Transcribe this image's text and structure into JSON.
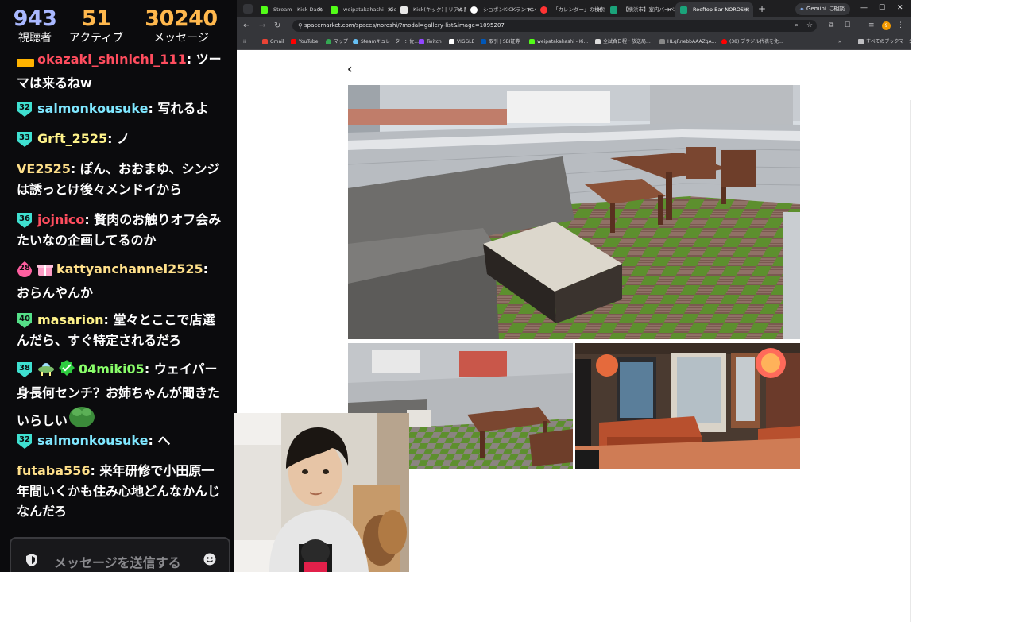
{
  "stream_stats": {
    "viewers": {
      "value": "943",
      "label": "視聴者"
    },
    "active": {
      "value": "51",
      "label": "アクティブ"
    },
    "messages": {
      "value": "30240",
      "label": "メッセージ"
    }
  },
  "chat": {
    "messages": [
      {
        "level": "",
        "user": "okazaki_shinichi_111",
        "user_color": "#ff4d5e",
        "text": ": ツーマは来るねw"
      },
      {
        "level": "32",
        "user": "salmonkousuke",
        "user_color": "#7fe7ff",
        "text": ": 写れるよ"
      },
      {
        "level": "33",
        "user": "Grft_2525",
        "user_color": "#fff38a",
        "text": ": ノ"
      },
      {
        "level": "",
        "user": "VE2525",
        "user_color": "#ffe08a",
        "text": ": ぽん、おおまゆ、シンジは誘っとけ後々メンドイから"
      },
      {
        "level": "36",
        "user": "jojnico",
        "user_color": "#ff4d5e",
        "text": ": 贅肉のお触りオフ会みたいなの企画してるのか"
      },
      {
        "level": "28",
        "user": "kattyanchannel2525",
        "user_color": "#ffe08a",
        "text": ": おらんやんか"
      },
      {
        "level": "40",
        "user": "masarion",
        "user_color": "#fff38a",
        "text": ": 堂々とここで店選んだら、すぐ特定されるだろ"
      },
      {
        "level": "38",
        "user": "04miki05",
        "user_color": "#8aff6a",
        "text": ": ウェイパー身長何センチ？お姉ちゃんが聞きたいらしい"
      },
      {
        "level": "32",
        "user": "salmonkousuke",
        "user_color": "#7fe7ff",
        "text": ": へ"
      },
      {
        "level": "",
        "user": "futaba556",
        "user_color": "#ffe08a",
        "text": ": 来年研修で小田原一年間いくかも住み心地どんなかんじなんだろ"
      }
    ],
    "input_placeholder": "メッセージを送信する"
  },
  "browser": {
    "tabs": [
      {
        "title": "Stream - Kick Dash",
        "fav_color": "#53fc18"
      },
      {
        "title": "weipatakahashi - Kick",
        "fav_color": "#53fc18"
      },
      {
        "title": "Kick(キック) | リアル配信",
        "fav_color": "#e8e8e8"
      },
      {
        "title": "ショボンKICKランキング",
        "fav_color": "#ffffff"
      },
      {
        "title": "「カレンダー」の検索結果",
        "fav_color": "#ff3333"
      },
      {
        "title": "【横浜市】室内バーベキュー",
        "fav_color": "#1aa37a"
      },
      {
        "title": "Rooftop Bar NOROSHI",
        "fav_color": "#1aa37a"
      }
    ],
    "gemini_label": "Gemini に相談",
    "url": "spacemarket.com/spaces/noroshi/?modal=gallery-list&image=1095207",
    "profile_initial": "9",
    "bookmarks": [
      {
        "label": "Gmail",
        "fav_color": "#ea4335"
      },
      {
        "label": "YouTube",
        "fav_color": "#ff0000"
      },
      {
        "label": "マップ",
        "fav_color": "#34a853"
      },
      {
        "label": "Steamキュレーター：佐...",
        "fav_color": "#66c0f4"
      },
      {
        "label": "Twitch",
        "fav_color": "#9146ff"
      },
      {
        "label": "VIGGLE",
        "fav_color": "#ffffff"
      },
      {
        "label": "取引 | SBI証券",
        "fav_color": "#0057b8"
      },
      {
        "label": "weipatakahashi - Ki...",
        "fav_color": "#53fc18"
      },
      {
        "label": "全試合日程・放送局...",
        "fav_color": "#dddddd"
      },
      {
        "label": "HLqRnebbAAAZqA...",
        "fav_color": "#888888"
      },
      {
        "label": "(38) ブラジル代表を免...",
        "fav_color": "#ff0000"
      }
    ],
    "all_bookmarks_label": "すべてのブックマーク"
  }
}
